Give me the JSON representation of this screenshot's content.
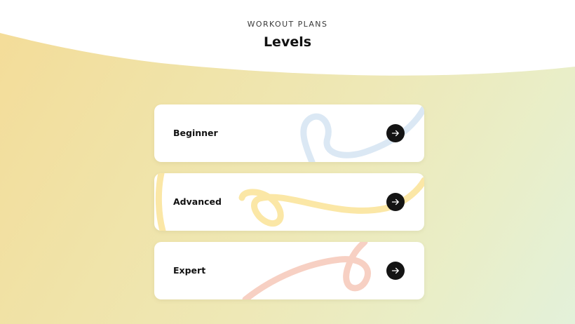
{
  "header": {
    "eyebrow": "WORKOUT PLANS",
    "title": "Levels"
  },
  "levels": [
    {
      "label": "Beginner",
      "accent": "#dbe8f4"
    },
    {
      "label": "Advanced",
      "accent": "#fbe7a6"
    },
    {
      "label": "Expert",
      "accent": "#f7d0c3"
    }
  ],
  "colors": {
    "background_start": "#f4dc98",
    "background_end": "#e3f1da",
    "button": "#141414"
  },
  "icons": {
    "level_button": "arrow-right-icon"
  }
}
